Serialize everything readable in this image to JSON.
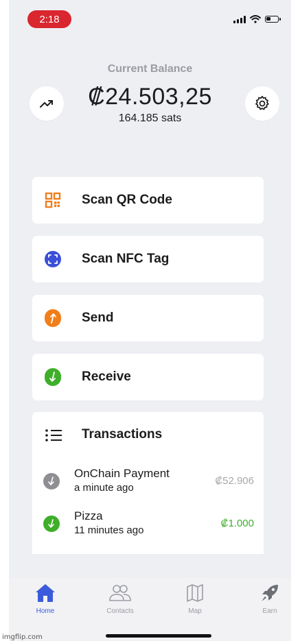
{
  "status_bar": {
    "time": "2:18"
  },
  "balance": {
    "label": "Current Balance",
    "amount": "₡24.503,25",
    "sats": "164.185 sats"
  },
  "header_buttons": {
    "left_icon": "trending-up-icon",
    "right_icon": "gear-icon"
  },
  "actions": [
    {
      "label": "Scan QR Code",
      "icon": "qr-code-icon",
      "color": "#f07e1b"
    },
    {
      "label": "Scan NFC Tag",
      "icon": "nfc-scan-icon",
      "color": "#3b4fd8"
    },
    {
      "label": "Send",
      "icon": "send-arrow-icon",
      "color": "#f07e1b"
    },
    {
      "label": "Receive",
      "icon": "receive-arrow-icon",
      "color": "#3fae2a"
    }
  ],
  "transactions": {
    "title": "Transactions",
    "items": [
      {
        "title": "OnChain Payment",
        "time": "a minute ago",
        "amount": "₡52.906",
        "amount_color": "#a7a9ae",
        "icon_color": "#8e8e93"
      },
      {
        "title": "Pizza",
        "time": "11 minutes ago",
        "amount": "₡1.000",
        "amount_color": "#3fae2a",
        "icon_color": "#3fae2a"
      }
    ]
  },
  "tabs": [
    {
      "label": "Home",
      "icon": "home-icon",
      "active": true
    },
    {
      "label": "Contacts",
      "icon": "contacts-icon",
      "active": false
    },
    {
      "label": "Map",
      "icon": "map-icon",
      "active": false
    },
    {
      "label": "Earn",
      "icon": "rocket-icon",
      "active": false
    }
  ],
  "watermark": "imgflip.com",
  "colors": {
    "accent": "#3b5bdb",
    "background": "#eeeff3",
    "time_pill": "#d9262f"
  }
}
